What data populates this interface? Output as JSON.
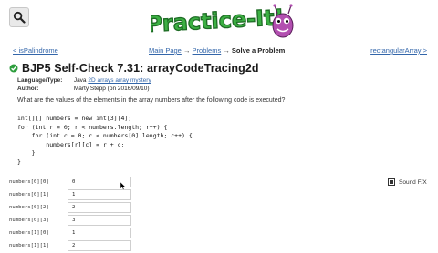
{
  "header": {
    "logo_text": "Practice-It!"
  },
  "nav": {
    "prev_label": "< isPalindrome",
    "crumbs": [
      "Main Page",
      "Problems",
      "Solve a Problem"
    ],
    "separator": "→",
    "next_label": "rectangularArray >"
  },
  "problem": {
    "title": "BJP5 Self-Check 7.31: arrayCodeTracing2d",
    "language_label": "Language/Type:",
    "language_value": "Java",
    "language_links": "2D arrays array mystery",
    "author_label": "Author:",
    "author_value": "Marty Stepp (on 2016/09/10)",
    "question": "What are the values of the elements in the array numbers after the following code is executed?"
  },
  "code_lines": [
    "int[][] numbers = new int[3][4];",
    "for (int r = 0; r < numbers.length; r++) {",
    "    for (int c = 0; c < numbers[0].length; c++) {",
    "        numbers[r][c] = r + c;",
    "    }",
    "}"
  ],
  "answers": [
    {
      "label": "numbers[0][0]",
      "value": "0"
    },
    {
      "label": "numbers[0][1]",
      "value": "1"
    },
    {
      "label": "numbers[0][2]",
      "value": "2"
    },
    {
      "label": "numbers[0][3]",
      "value": "3"
    },
    {
      "label": "numbers[1][0]",
      "value": "1"
    },
    {
      "label": "numbers[1][1]",
      "value": "2"
    }
  ],
  "sound": {
    "label": "Sound F/X",
    "checked": true
  },
  "colors": {
    "logo_green": "#3cb043",
    "link": "#3366aa",
    "check_green": "#2e9e3e"
  }
}
